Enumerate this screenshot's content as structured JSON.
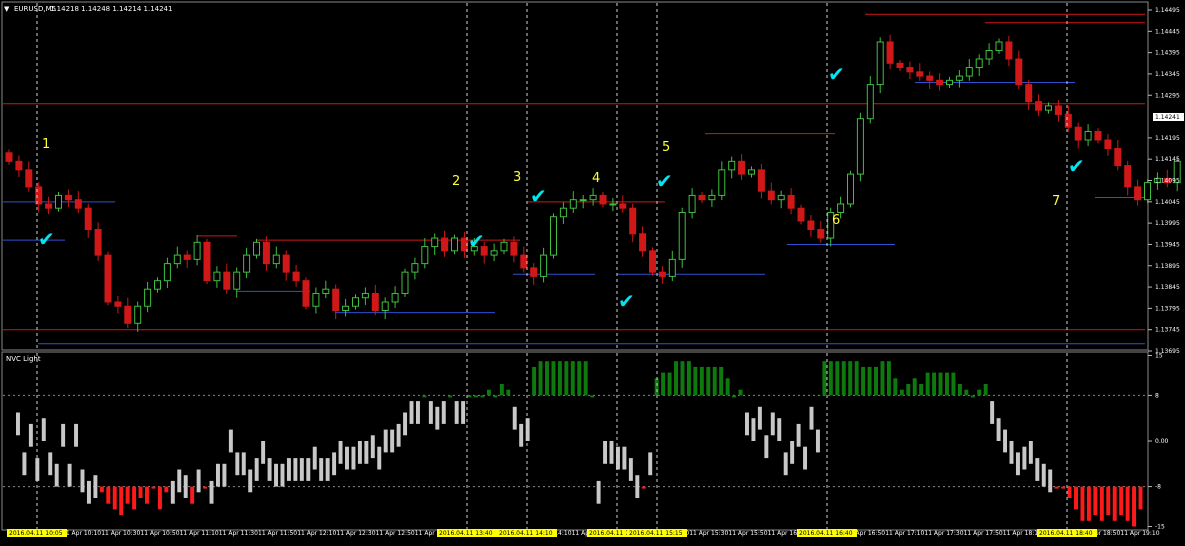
{
  "symbol_bar": {
    "symbol": "EURUSD,M5",
    "ohlc": "1.14218 1.14248 1.14214 1.14241"
  },
  "indicator_title": "NVC Light",
  "current_price": "1.14241",
  "colors": {
    "background": "#000000",
    "bull": "#3fbf3f",
    "bear": "#d01818",
    "resistance": "#d01818",
    "support": "#3050d0",
    "hist_gray": "#c8c8c8",
    "hist_green": "#0e7a0e",
    "hist_red": "#ff1a1a",
    "marker_text": "#ffff33",
    "check": "#00e5ee"
  },
  "markers": [
    "1",
    "2",
    "3",
    "4",
    "5",
    "6",
    "7"
  ],
  "checkmark_icon": "check-icon",
  "chart_data": {
    "type": "candlestick",
    "price_ticks": [
      "1.14495",
      "1.14445",
      "1.14395",
      "1.14345",
      "1.14295",
      "1.14195",
      "1.14145",
      "1.14095",
      "1.14045",
      "1.13995",
      "1.13945",
      "1.13895",
      "1.13845",
      "1.13795",
      "1.13745",
      "1.13695"
    ],
    "indicator_ticks": [
      "15",
      "8",
      "0.00",
      "-8",
      "-15"
    ],
    "time_labels": [
      "11 Apr 10:10",
      "11 Apr 10:30",
      "11 Apr 10:50",
      "11 Apr 11:10",
      "11 Apr 11:30",
      "11 Apr 11:50",
      "11 Apr 12:10",
      "11 Apr 12:30",
      "11 Apr 12:50",
      "11 Apr 13:10",
      "11 Apr 13:30",
      "11 Apr 13:50",
      "11 Apr 14:10",
      "11 Apr 14:30",
      "11 Apr 14:50",
      "11 Apr 15:10",
      "11 Apr 15:30",
      "11 Apr 15:50",
      "11 Apr 16:10",
      "11 Apr 16:30",
      "11 Apr 16:50",
      "11 Apr 17:10",
      "11 Apr 17:30",
      "11 Apr 17:50",
      "11 Apr 18:10",
      "11 Apr 18:30",
      "11 Apr 18:50",
      "11 Apr 19:10"
    ],
    "highlighted_times": [
      "2016.04.11 10:05",
      "2016.04.11 13:40",
      "2016.04.11 14:10",
      "2016.04.11 14:",
      "2016.04.11 15:15",
      "2016.04.11 16:40",
      "2016.04.11 18:40"
    ],
    "closes": [
      1.1414,
      1.1412,
      1.1408,
      1.1404,
      1.1403,
      1.1406,
      1.1405,
      1.1403,
      1.1398,
      1.1392,
      1.1381,
      1.138,
      1.1376,
      1.138,
      1.1384,
      1.1386,
      1.139,
      1.1392,
      1.1391,
      1.1395,
      1.1386,
      1.1388,
      1.1384,
      1.1388,
      1.1392,
      1.1395,
      1.139,
      1.1392,
      1.1388,
      1.1386,
      1.138,
      1.1383,
      1.1384,
      1.1379,
      1.138,
      1.1382,
      1.1383,
      1.1379,
      1.1381,
      1.1383,
      1.1388,
      1.139,
      1.1394,
      1.1396,
      1.1393,
      1.1396,
      1.1393,
      1.1394,
      1.1392,
      1.1393,
      1.1395,
      1.1392,
      1.1389,
      1.1387,
      1.1392,
      1.1401,
      1.1403,
      1.1405,
      1.1405,
      1.1406,
      1.1404,
      1.1404,
      1.1403,
      1.1397,
      1.1393,
      1.1388,
      1.1387,
      1.1391,
      1.1402,
      1.1406,
      1.1405,
      1.1406,
      1.1412,
      1.1414,
      1.1411,
      1.1412,
      1.1407,
      1.1405,
      1.1406,
      1.1403,
      1.14,
      1.1398,
      1.1396,
      1.1402,
      1.1404,
      1.1411,
      1.1424,
      1.1432,
      1.1442,
      1.1437,
      1.1436,
      1.1435,
      1.1434,
      1.1433,
      1.1432,
      1.1433,
      1.1434,
      1.1436,
      1.1438,
      1.144,
      1.1442,
      1.1438,
      1.1432,
      1.1428,
      1.1426,
      1.1427,
      1.1425,
      1.1422,
      1.1419,
      1.1421,
      1.1419,
      1.1417,
      1.1413,
      1.1408,
      1.1405,
      1.1409,
      1.141,
      1.1409,
      1.1414
    ],
    "support_lines": [
      [
        1.14045,
        3,
        115
      ],
      [
        1.13955,
        3,
        65
      ],
      [
        1.13835,
        237,
        310
      ],
      [
        1.13785,
        335,
        495
      ],
      [
        1.13875,
        513,
        595
      ],
      [
        1.13875,
        617,
        765
      ],
      [
        1.13945,
        787,
        895
      ],
      [
        1.14325,
        915,
        1075
      ],
      [
        1.14055,
        1095,
        1145
      ],
      [
        1.13712,
        38,
        1145
      ]
    ],
    "resistance_lines": [
      [
        1.14275,
        3,
        1145
      ],
      [
        1.13965,
        197,
        237
      ],
      [
        1.13955,
        257,
        520
      ],
      [
        1.14045,
        527,
        665
      ],
      [
        1.14205,
        705,
        835
      ],
      [
        1.14485,
        865,
        1145
      ],
      [
        1.14465,
        985,
        1145
      ],
      [
        1.13745,
        3,
        1145
      ]
    ],
    "histogram": [
      5,
      -2,
      3,
      -3,
      4,
      -2,
      -4,
      3,
      -4,
      3,
      -5,
      -7,
      -6,
      -9,
      -11,
      -12,
      -13,
      -11,
      -12,
      -10,
      -11,
      -8,
      -12,
      -9,
      -7,
      -5,
      -6,
      -11,
      -5,
      -8,
      -7,
      -4,
      -4,
      2,
      -2,
      -2,
      -5,
      -3,
      0,
      -3,
      -4,
      -4,
      -3,
      -3,
      -3,
      -3,
      -1,
      -3,
      -3,
      -2,
      0,
      -1,
      -1,
      0,
      0,
      1,
      -1,
      2,
      2,
      3,
      5,
      7,
      7,
      8,
      7,
      6,
      7,
      8,
      7,
      7,
      8,
      8,
      8,
      9,
      8,
      10,
      9,
      6,
      3,
      4,
      13,
      14,
      14,
      14,
      14,
      14,
      14,
      14,
      14,
      8,
      -7,
      0,
      0,
      -1,
      -1,
      -3,
      -6,
      -8,
      -2,
      11,
      12,
      12,
      14,
      14,
      14,
      13,
      13,
      13,
      13,
      13,
      11,
      8,
      9,
      5,
      4,
      6,
      1,
      5,
      4,
      -2,
      0,
      3,
      -1,
      6,
      2,
      14,
      14,
      14,
      14,
      14,
      14,
      13,
      13,
      13,
      14,
      14,
      11,
      9,
      10,
      11,
      10,
      12,
      12,
      12,
      12,
      12,
      10,
      9,
      8,
      9,
      10,
      7,
      4,
      2,
      0,
      -2,
      -1,
      0,
      -3,
      -4,
      -5,
      -8,
      -8,
      -10,
      -12,
      -14,
      -14,
      -13,
      -14,
      -13,
      -14,
      -13,
      -14,
      -15,
      -12
    ],
    "signal_x": [
      37,
      467,
      527,
      617,
      657,
      827,
      1067
    ]
  }
}
